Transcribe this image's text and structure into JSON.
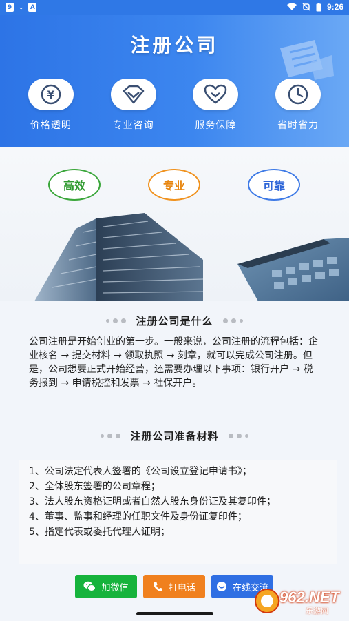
{
  "status_bar": {
    "time": "9:26",
    "badge_left": "9",
    "badge_a": "A"
  },
  "hero": {
    "title": "注册公司",
    "features": [
      {
        "label": "价格透明",
        "icon": "yen-icon"
      },
      {
        "label": "专业咨询",
        "icon": "diamond-icon"
      },
      {
        "label": "服务保障",
        "icon": "heart-icon"
      },
      {
        "label": "省时省力",
        "icon": "clock-icon"
      }
    ]
  },
  "promo": {
    "badges": [
      {
        "label": "高效",
        "color": "#2f9a2f"
      },
      {
        "label": "专业",
        "color": "#e8860f"
      },
      {
        "label": "可靠",
        "color": "#3067d8"
      }
    ]
  },
  "section1": {
    "title": "注册公司是什么",
    "body": "公司注册是开始创业的第一步。一般来说，公司注册的流程包括：企业核名 → 提交材料 → 领取执照 → 刻章，就可以完成公司注册。但是，公司想要正式开始经营，还需要办理以下事项：银行开户 → 税务报到 → 申请税控和发票 → 社保开户。"
  },
  "section2": {
    "title": "注册公司准备材料",
    "items": [
      "1、公司法定代表人签署的《公司设立登记申请书》；",
      "2、全体股东签署的公司章程；",
      "3、法人股东资格证明或者自然人股东身份证及其复印件；",
      "4、董事、监事和经理的任职文件及身份证复印件；",
      "5、指定代表或委托代理人证明；"
    ]
  },
  "actions": {
    "wechat": "加微信",
    "call": "打电话",
    "chat": "在线交流"
  },
  "watermark": {
    "brand": "962.NET",
    "sub": "乐游网"
  },
  "colors": {
    "primary": "#2f78e6",
    "wechat": "#16b33c",
    "call": "#f0801e",
    "chat": "#2f6fe3"
  }
}
